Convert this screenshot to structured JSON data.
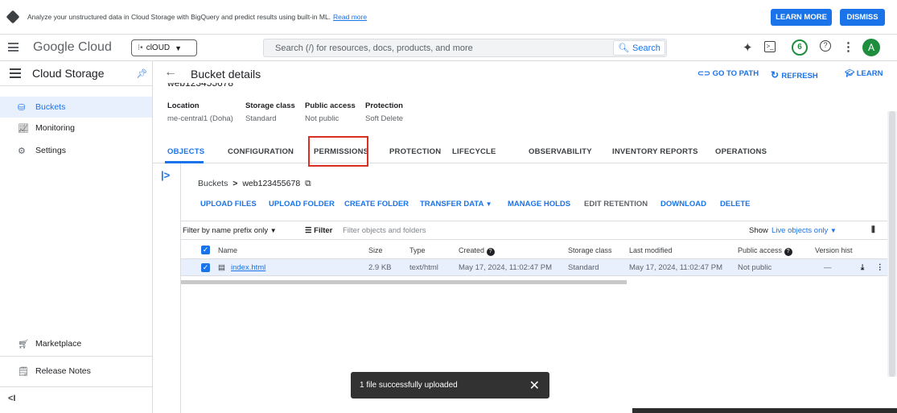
{
  "banner": {
    "text": "Analyze your unstructured data in Cloud Storage with BigQuery and predict results using built-in ML.",
    "link": "Read more",
    "learn_more": "LEARN MORE",
    "dismiss": "DISMISS"
  },
  "topbar": {
    "brand": "Google Cloud",
    "project": "clOUD",
    "search_placeholder": "Search (/) for resources, docs, products, and more",
    "search_button": "Search",
    "notif_count": "6",
    "avatar": "A"
  },
  "sidebar": {
    "title": "Cloud Storage",
    "items": [
      {
        "label": "Buckets",
        "icon": "bucket-icon"
      },
      {
        "label": "Monitoring",
        "icon": "chart-icon"
      },
      {
        "label": "Settings",
        "icon": "gear-icon"
      }
    ],
    "bottom": [
      {
        "label": "Marketplace",
        "icon": "cart-icon"
      },
      {
        "label": "Release Notes",
        "icon": "notes-icon"
      }
    ],
    "collapse": "<I"
  },
  "header": {
    "title": "Bucket details",
    "go_to_path": "GO TO PATH",
    "refresh": "REFRESH",
    "learn": "LEARN",
    "bucket_name_clipped": "web123455678"
  },
  "info": {
    "location_label": "Location",
    "location_value": "me-central1 (Doha)",
    "class_label": "Storage class",
    "class_value": "Standard",
    "access_label": "Public access",
    "access_value": "Not public",
    "protection_label": "Protection",
    "protection_value": "Soft Delete"
  },
  "tabs": [
    "OBJECTS",
    "CONFIGURATION",
    "PERMISSIONS",
    "PROTECTION",
    "LIFECYCLE",
    "OBSERVABILITY",
    "INVENTORY REPORTS",
    "OPERATIONS"
  ],
  "breadcrumb": {
    "root": "Buckets",
    "bucket": "web123455678"
  },
  "actions": [
    "UPLOAD FILES",
    "UPLOAD FOLDER",
    "CREATE FOLDER",
    "TRANSFER DATA",
    "MANAGE HOLDS",
    "EDIT RETENTION",
    "DOWNLOAD",
    "DELETE"
  ],
  "filter": {
    "prefix": "Filter by name prefix only",
    "label": "Filter",
    "placeholder": "Filter objects and folders",
    "show": "Show",
    "show_value": "Live objects only"
  },
  "table": {
    "headers": [
      "Name",
      "Size",
      "Type",
      "Created",
      "Storage class",
      "Last modified",
      "Public access",
      "Version hist"
    ],
    "rows": [
      {
        "name": "index.html",
        "size": "2.9 KB",
        "type": "text/html",
        "created": "May 17, 2024, 11:02:47 PM",
        "class": "Standard",
        "modified": "May 17, 2024, 11:02:47 PM",
        "access": "Not public",
        "version": "—"
      }
    ]
  },
  "toast": {
    "message": "1 file successfully uploaded",
    "close": "✕"
  }
}
